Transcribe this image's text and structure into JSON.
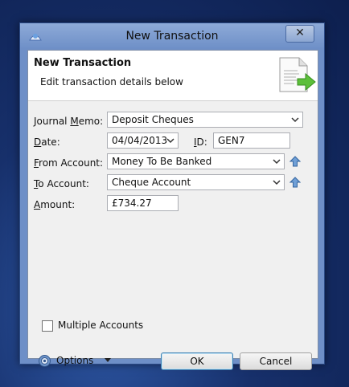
{
  "window": {
    "title": "New Transaction",
    "close_label": "✕"
  },
  "header": {
    "title": "New Transaction",
    "subtitle": "Edit transaction details below"
  },
  "form": {
    "journal_memo": {
      "label": "Journal Memo:",
      "value": "Deposit Cheques"
    },
    "date": {
      "label": "Date:",
      "value": "04/04/2013"
    },
    "id": {
      "label": "ID:",
      "value": "GEN7"
    },
    "from_account": {
      "label": "From Account:",
      "value": "Money To Be Banked"
    },
    "to_account": {
      "label": "To Account:",
      "value": "Cheque Account"
    },
    "amount": {
      "label": "Amount:",
      "value": "£734.27"
    },
    "multiple_accounts": {
      "label": "Multiple Accounts",
      "checked": false
    }
  },
  "footer": {
    "options_label": "Options",
    "ok_label": "OK",
    "cancel_label": "Cancel"
  },
  "icons": {
    "app": "app-logo-icon",
    "header": "document-arrow-icon",
    "combo": "chevron-down-icon",
    "swap": "up-arrow-icon",
    "options": "gear-icon"
  },
  "colors": {
    "window_frame": "#6e8fc7",
    "default_button_border": "#3c7fb1"
  }
}
